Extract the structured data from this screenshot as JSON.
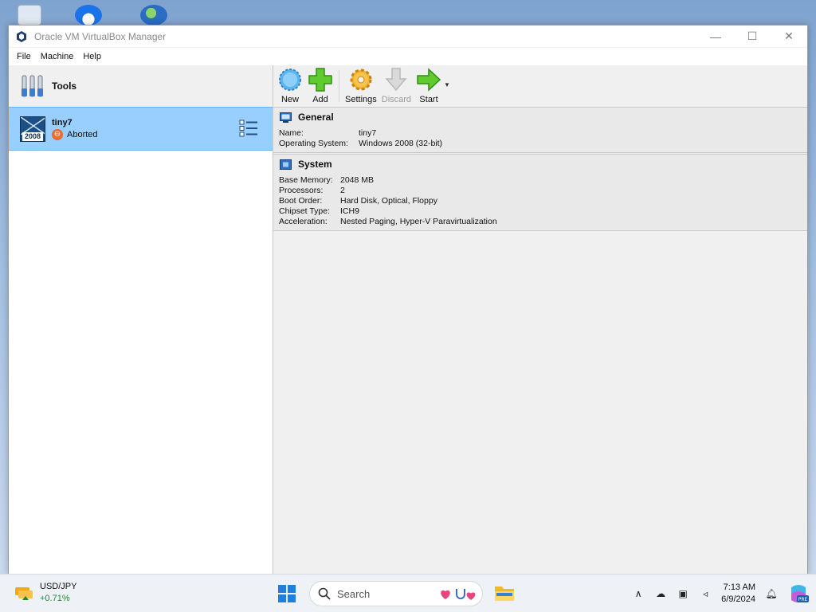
{
  "window": {
    "title": "Oracle VM VirtualBox Manager",
    "minimize_glyph": "—",
    "maximize_glyph": "☐",
    "close_glyph": "✕"
  },
  "menu": {
    "items": [
      {
        "label": "File"
      },
      {
        "label": "Machine"
      },
      {
        "label": "Help"
      }
    ]
  },
  "left_panel": {
    "tools_label": "Tools",
    "vm": {
      "name": "tiny7",
      "state": "Aborted",
      "os_badge": "2008"
    }
  },
  "toolbar": {
    "new_label": "New",
    "add_label": "Add",
    "settings_label": "Settings",
    "discard_label": "Discard",
    "start_label": "Start",
    "start_dropdown_glyph": "▼"
  },
  "details": {
    "general": {
      "title": "General",
      "rows": [
        {
          "key": "Name:",
          "value": "tiny7"
        },
        {
          "key": "Operating System:",
          "value": "Windows 2008 (32-bit)"
        }
      ]
    },
    "system": {
      "title": "System",
      "rows": [
        {
          "key": "Base Memory:",
          "value": "2048 MB"
        },
        {
          "key": "Processors:",
          "value": "2"
        },
        {
          "key": "Boot Order:",
          "value": "Hard Disk, Optical, Floppy"
        },
        {
          "key": "Chipset Type:",
          "value": "ICH9"
        },
        {
          "key": "Acceleration:",
          "value": "Nested Paging, Hyper-V Paravirtualization"
        }
      ]
    }
  },
  "taskbar": {
    "widget_title": "USD/JPY",
    "widget_change": "+0.71%",
    "search_placeholder": "Search",
    "time": "7:13 AM",
    "date": "6/9/2024",
    "copilot_badge": "PRE"
  },
  "colors": {
    "selection": "#99cfff",
    "accent": "#2b7bd6",
    "abort": "#e96b2f",
    "widget_positive": "#1a8a2e"
  }
}
